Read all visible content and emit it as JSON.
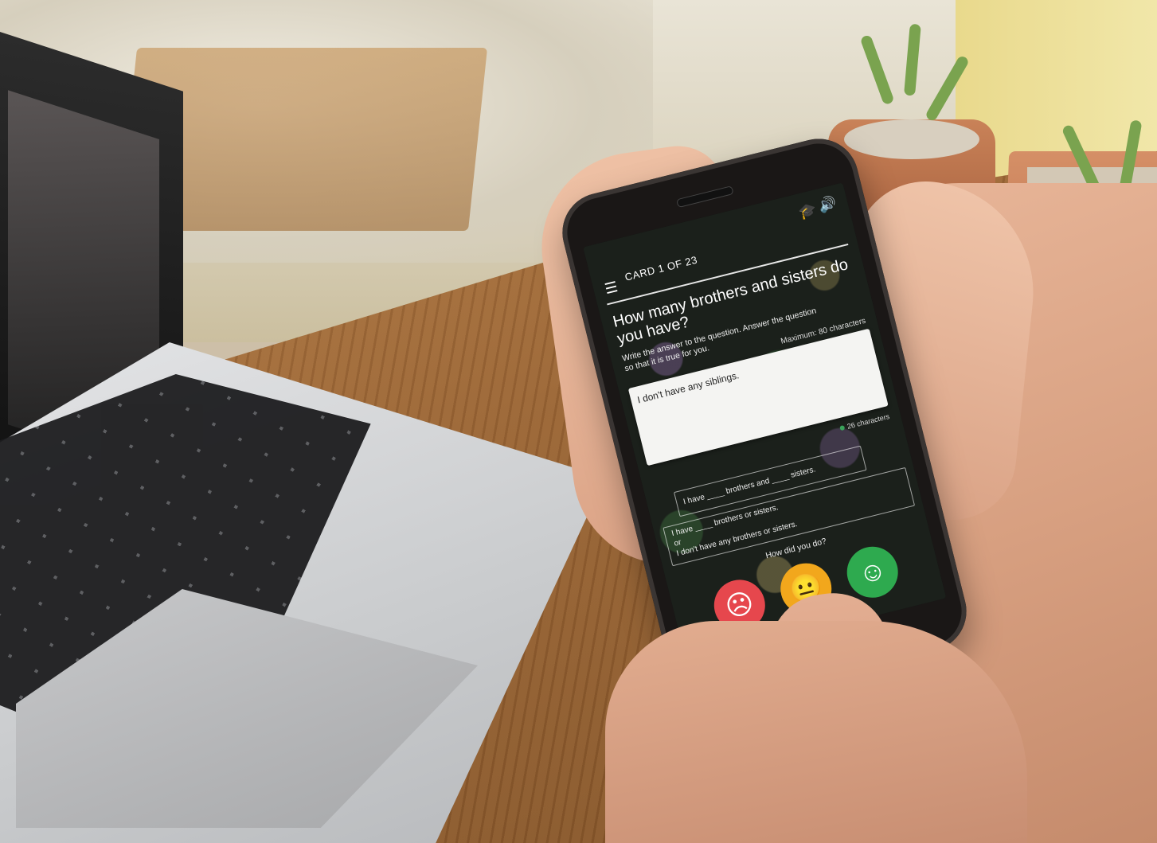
{
  "phone_app": {
    "card_label": "CARD 1 OF 23",
    "card_sub": "",
    "question": "How many brothers and sisters do you have?",
    "instruction": "Write the answer to the question. Answer the question so that it is true for you.",
    "max_chars": "Maximum: 80 characters",
    "answer": "I don't have any siblings.",
    "char_count": "26 characters",
    "hint": "I have ____ brothers and ____ sisters.",
    "alt_line1": "I have ____ brothers or sisters.",
    "alt_line2": "or",
    "alt_line3": "I don't have any brothers or sisters.",
    "how_did_you_do": "How did you do?",
    "rating_faces": [
      "sad",
      "neutral",
      "happy"
    ]
  },
  "icons": {
    "menu": "☰",
    "graduation_cap": "🎓",
    "sound": "🔊",
    "sad_face": "☹",
    "neutral_face": "😐",
    "happy_face": "☺"
  },
  "colors": {
    "sad": "#e6474d",
    "neutral": "#f2a71c",
    "happy": "#2eaa4f"
  }
}
